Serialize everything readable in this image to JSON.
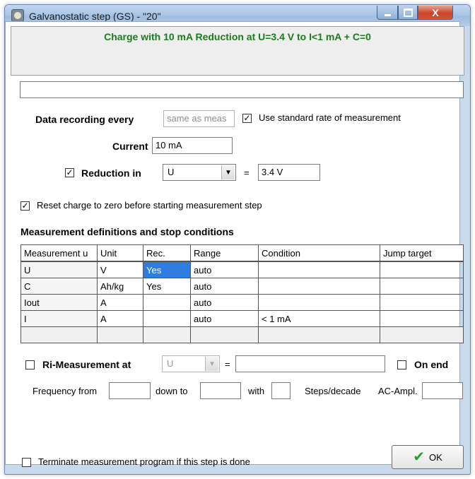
{
  "window": {
    "title": "Galvanostatic step (GS) - \"20\"",
    "buttons": {
      "minimize": "minimize-icon",
      "maximize": "maximize-icon",
      "close_label": "X"
    }
  },
  "description": "Charge with 10 mA Reduction at U=3.4 V to I<1 mA + C=0",
  "note": {
    "value": ""
  },
  "data_recording": {
    "label": "Data recording every",
    "value": "same as meas",
    "use_standard_checked": true,
    "use_standard_label": "Use standard rate of measurement"
  },
  "current": {
    "label": "Current",
    "value": "10 mA"
  },
  "reduction": {
    "checked": true,
    "label": "Reduction in",
    "select_value": "U",
    "equals": "=",
    "value": "3.4 V"
  },
  "reset_charge": {
    "checked": true,
    "label": "Reset charge to zero before starting measurement step"
  },
  "measurement_section": {
    "title": "Measurement definitions and stop conditions",
    "columns": [
      "Measurement u",
      "Unit",
      "Rec.",
      "Range",
      "Condition",
      "Jump target"
    ],
    "rows": [
      [
        "U",
        "V",
        "Yes",
        "auto",
        "",
        ""
      ],
      [
        "C",
        "Ah/kg",
        "Yes",
        "auto",
        "",
        ""
      ],
      [
        "Iout",
        "A",
        "",
        "auto",
        "",
        ""
      ],
      [
        "I",
        "A",
        "",
        "auto",
        "< 1 mA",
        ""
      ],
      [
        "",
        "",
        "",
        "",
        "",
        ""
      ]
    ]
  },
  "ri_measurement": {
    "checked": false,
    "label": "Ri-Measurement at",
    "select_value": "U",
    "equals": "=",
    "value": "",
    "on_end_checked": false,
    "on_end_label": "On end"
  },
  "frequency": {
    "from_label": "Frequency from",
    "from_value": "",
    "down_to_label": "down to",
    "down_to_value": "",
    "with_label": "with",
    "with_value": "",
    "steps_label": "Steps/decade",
    "ac_ampl_label": "AC-Ampl.",
    "ac_ampl_value": ""
  },
  "terminate": {
    "checked": false,
    "label": "Terminate measurement program if this step is done"
  },
  "ok_button": {
    "label": "OK",
    "icon": "checkmark-icon"
  },
  "colors": {
    "description_text": "#1c7b1c",
    "selection": "#2f7de1",
    "close_button": "#c9452c"
  }
}
